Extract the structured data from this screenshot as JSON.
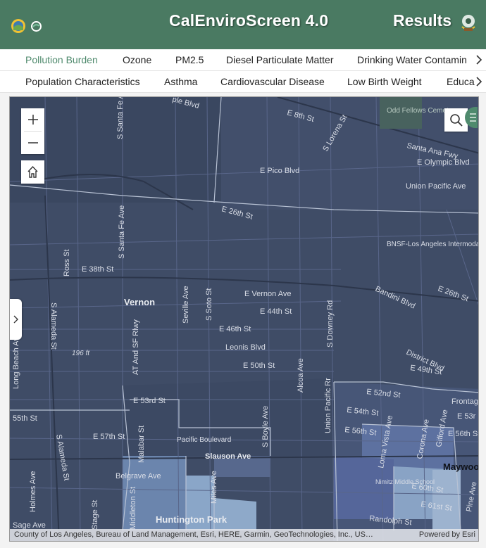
{
  "header": {
    "title": "CalEnviroScreen 4.0",
    "results_label": "Results"
  },
  "tabs_row1": [
    {
      "label": "Pollution Burden",
      "active": true
    },
    {
      "label": "Ozone"
    },
    {
      "label": "PM2.5"
    },
    {
      "label": "Diesel Particulate Matter"
    },
    {
      "label": "Drinking Water Contamin"
    }
  ],
  "tabs_row2": [
    {
      "label": "Population Characteristics"
    },
    {
      "label": "Asthma"
    },
    {
      "label": "Cardiovascular Disease"
    },
    {
      "label": "Low Birth Weight"
    },
    {
      "label": "Educa"
    }
  ],
  "map": {
    "labels": {
      "vernon": "Vernon",
      "huntington_park": "Huntington Park",
      "maywood": "Maywood",
      "pacific_boulevard": "Pacific Boulevard",
      "odd_fellows": "Odd Fellows Cemetery",
      "bnsf": "BNSF-Los Angeles Intermodal",
      "nimitz": "Nimitz Middle School",
      "santa_ana_fwy": "Santa Ana Fwy",
      "e_pico": "E Pico Blvd",
      "e_olympic": "E Olympic Blvd",
      "union_pacific_ave": "Union Pacific Ave",
      "e_26th": "E 26th St",
      "e_26th_right": "E 26th St",
      "e_38th": "E 38th St",
      "e_vernon": "E Vernon Ave",
      "e_44th": "E 44th St",
      "e_46th": "E 46th St",
      "leonis": "Leonis Blvd",
      "e_50th": "E 50th St",
      "e_49th": "E 49th St",
      "e_52nd": "E 52nd St",
      "e_53rd": "E 53rd St",
      "e_54th": "E 54th St",
      "e_56th": "E 56th St",
      "e_57th": "E 57th St",
      "slauson": "Slauson Ave",
      "belgrave": "Belgrave Ave",
      "e_60th": "E 60th St",
      "e_61st": "E 61st St",
      "randolph": "Randolph St",
      "bandini": "Bandini Blvd",
      "district": "District Blvd",
      "s_alameda": "S Alameda St",
      "s_alameda2": "S Alameda St",
      "s_santa_fe": "S Santa Fe Ave",
      "s_santa_fe2": "S Santa Fe Ave",
      "s_soto": "S Soto St",
      "s_downey": "S Downey Rd",
      "seville": "Seville Ave",
      "alcoa": "Alcoa Ave",
      "s_boyle": "S Boyle Ave",
      "at_sf": "AT And SF Rlwy",
      "union_pacific_rr": "Union Pacific Rr",
      "malabar": "Malabar St",
      "long_beach": "Long Beach Ave",
      "ross": "Ross St",
      "st_55th": "55th St",
      "st_196th": "196 ft",
      "e_8th": "E 8th St",
      "s_lorena": "S Lorena St",
      "loma_vista": "Loma Vista Ave",
      "corona": "Corona Ave",
      "gifford": "Gifford Ave",
      "frontage": "Frontage",
      "e_53rd_r": "E 53r",
      "e_56th_r": "E 56th St",
      "pine": "Pine Ave",
      "holmes": "Holmes Ave",
      "miles": "Miles Ave",
      "middleton": "Middleton St",
      "stage": "Stage St",
      "sage": "Sage Ave",
      "pic_blvd": "ple Blvd"
    },
    "attribution": "County of Los Angeles, Bureau of Land Management, Esri, HERE, Garmin, GeoTechnologies, Inc., US…",
    "powered_by": "Powered by Esri"
  }
}
